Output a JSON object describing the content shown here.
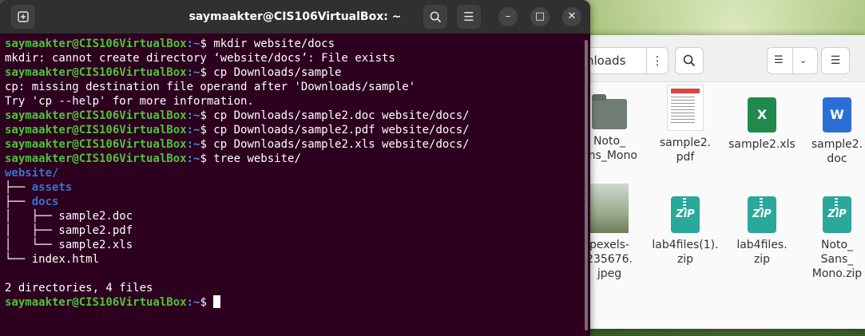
{
  "terminal": {
    "title": "saymaakter@CIS106VirtualBox: ~",
    "prompt_user": "saymaakter@CIS106VirtualBox",
    "prompt_path": ":~",
    "prompt_symbol": "$ ",
    "lines": [
      {
        "kind": "prompt",
        "cmd": "mkdir website/docs"
      },
      {
        "kind": "out",
        "text": "mkdir: cannot create directory ‘website/docs’: File exists"
      },
      {
        "kind": "prompt",
        "cmd": "cp Downloads/sample"
      },
      {
        "kind": "out",
        "text": "cp: missing destination file operand after 'Downloads/sample'"
      },
      {
        "kind": "out",
        "text": "Try 'cp --help' for more information."
      },
      {
        "kind": "prompt",
        "cmd": "cp Downloads/sample2.doc website/docs/"
      },
      {
        "kind": "prompt",
        "cmd": "cp Downloads/sample2.pdf website/docs/"
      },
      {
        "kind": "prompt",
        "cmd": "cp Downloads/sample2.xls website/docs/"
      },
      {
        "kind": "prompt",
        "cmd": "tree website/"
      },
      {
        "kind": "dir",
        "prefix": "",
        "text": "website/"
      },
      {
        "kind": "dir",
        "prefix": "├── ",
        "text": "assets"
      },
      {
        "kind": "dir",
        "prefix": "├── ",
        "text": "docs"
      },
      {
        "kind": "out",
        "text": "│   ├── sample2.doc"
      },
      {
        "kind": "out",
        "text": "│   ├── sample2.pdf"
      },
      {
        "kind": "out",
        "text": "│   └── sample2.xls"
      },
      {
        "kind": "out",
        "text": "└── index.html"
      },
      {
        "kind": "out",
        "text": ""
      },
      {
        "kind": "out",
        "text": "2 directories, 4 files"
      },
      {
        "kind": "prompt_cursor",
        "cmd": ""
      }
    ]
  },
  "file_manager": {
    "breadcrumb": "nloads",
    "more_icon": "⋮",
    "search_icon": "search-icon",
    "items": [
      {
        "label": "Noto_\nans_Mono",
        "icon": "folder"
      },
      {
        "label": "sample2.\npdf",
        "icon": "pdf"
      },
      {
        "label": "sample2.xls",
        "icon": "xls"
      },
      {
        "label": "sample2.\ndoc",
        "icon": "doc"
      },
      {
        "label": "pexels-\n235676.\njpeg",
        "icon": "photo"
      },
      {
        "label": "lab4files(1).\nzip",
        "icon": "zip"
      },
      {
        "label": "lab4files.\nzip",
        "icon": "zip"
      },
      {
        "label": "Noto_\nSans_\nMono.zip",
        "icon": "zip"
      }
    ]
  }
}
